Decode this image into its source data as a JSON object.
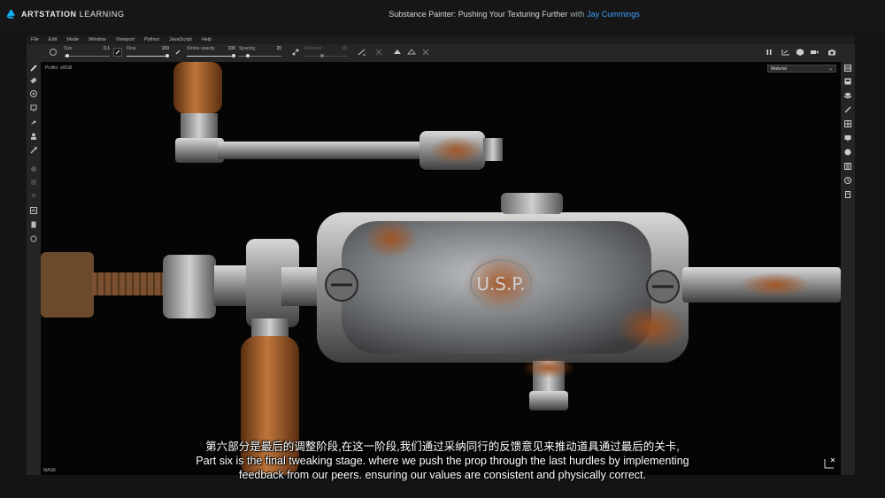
{
  "brand": {
    "name_bold": "ARTSTATION",
    "name_rest": "LEARNING",
    "accent": "#13aff0"
  },
  "course": {
    "title": "Substance Painter: Pushing Your Texturing Further",
    "by": "with",
    "author": "Jay Cummings",
    "author_color": "#3ba0ff"
  },
  "menu": [
    "File",
    "Edit",
    "Mode",
    "Window",
    "Viewport",
    "Python",
    "JavaScript",
    "Help"
  ],
  "toolbar": {
    "size_label": "Size",
    "size_value": "0.1",
    "flow_label": "Flow",
    "flow_value": "100",
    "stroke_label": "Stroke opacity",
    "stroke_value": "100",
    "spacing_label": "Spacing",
    "spacing_value": "20",
    "distance_label": "Distance",
    "distance_value": "10"
  },
  "viewport": {
    "profile": "Profile: sRGB",
    "channel": "Material",
    "mask_label": "MASK",
    "stamp_text": "U.S.P."
  },
  "subtitles": {
    "zh": "第六部分是最后的调整阶段,在这一阶段,我们通过采纳同行的反馈意见来推动道具通过最后的关卡,",
    "en1": "Part six is the final tweaking stage. where we push the prop through the last hurdles by implementing",
    "en2": "feedback from our peers. ensuring our values are consistent and physically correct."
  },
  "left_tools": [
    "paint-brush-icon",
    "eraser-icon",
    "projection-icon",
    "geometry-fill-icon",
    "smudge-icon",
    "clone-icon",
    "color-picker-icon",
    "material-icon",
    "layer-icon",
    "mask-icon",
    "document-icon",
    "settings-icon"
  ],
  "right_tools": [
    "texture-set-list-icon",
    "texture-set-settings-icon",
    "layers-icon",
    "properties-icon",
    "shelf-icon",
    "display-settings-icon",
    "environment-icon",
    "viewer-settings-icon",
    "history-icon",
    "log-icon"
  ]
}
